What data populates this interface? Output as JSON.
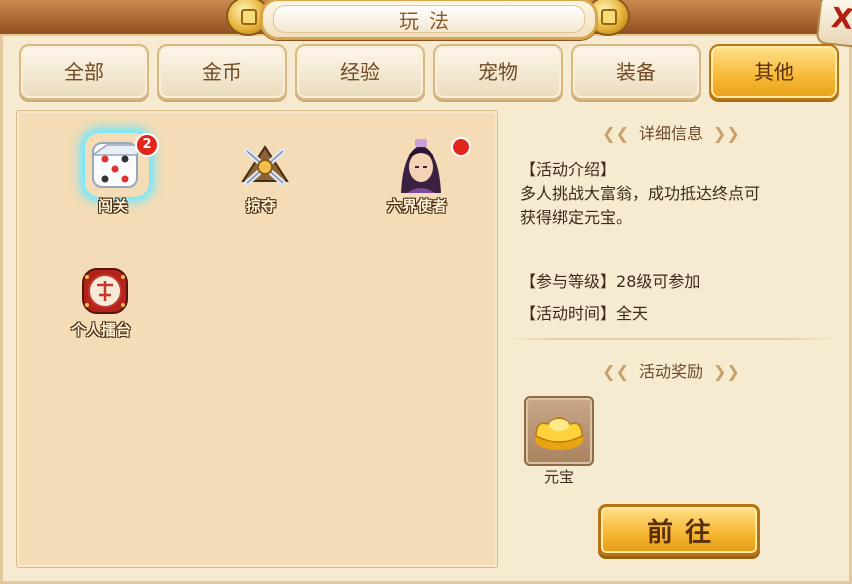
{
  "window": {
    "title": "玩法",
    "close_glyph": "X"
  },
  "tabs": [
    {
      "label": "全部",
      "active": false
    },
    {
      "label": "金币",
      "active": false
    },
    {
      "label": "经验",
      "active": false
    },
    {
      "label": "宠物",
      "active": false
    },
    {
      "label": "装备",
      "active": false
    },
    {
      "label": "其他",
      "active": true
    }
  ],
  "activities": [
    {
      "label": "闯关",
      "icon": "dice-icon",
      "badge": "2",
      "selected": true
    },
    {
      "label": "掠夺",
      "icon": "crossed-swords-icon",
      "badge": "",
      "selected": false
    },
    {
      "label": "六界使者",
      "icon": "messenger-portrait-icon",
      "badge_dot": true,
      "selected": false
    },
    {
      "label": "个人擂台",
      "icon": "war-drum-icon",
      "badge": "",
      "selected": false
    }
  ],
  "details": {
    "header": "详细信息",
    "intro_label": "【活动介绍】",
    "intro_line1": "多人挑战大富翁，成功抵达终点可",
    "intro_line2": "获得绑定元宝。",
    "level_label": "【参与等级】",
    "level_value": "28级可参加",
    "time_label": "【活动时间】",
    "time_value": "全天"
  },
  "reward": {
    "header": "活动奖励",
    "item_name": "元宝",
    "item_icon": "gold-ingot-icon"
  },
  "go_button": {
    "label": "前往"
  },
  "colors": {
    "active_tab": "#f7b834",
    "badge_red": "#e3261c",
    "selection_glow": "#66e6ff"
  }
}
